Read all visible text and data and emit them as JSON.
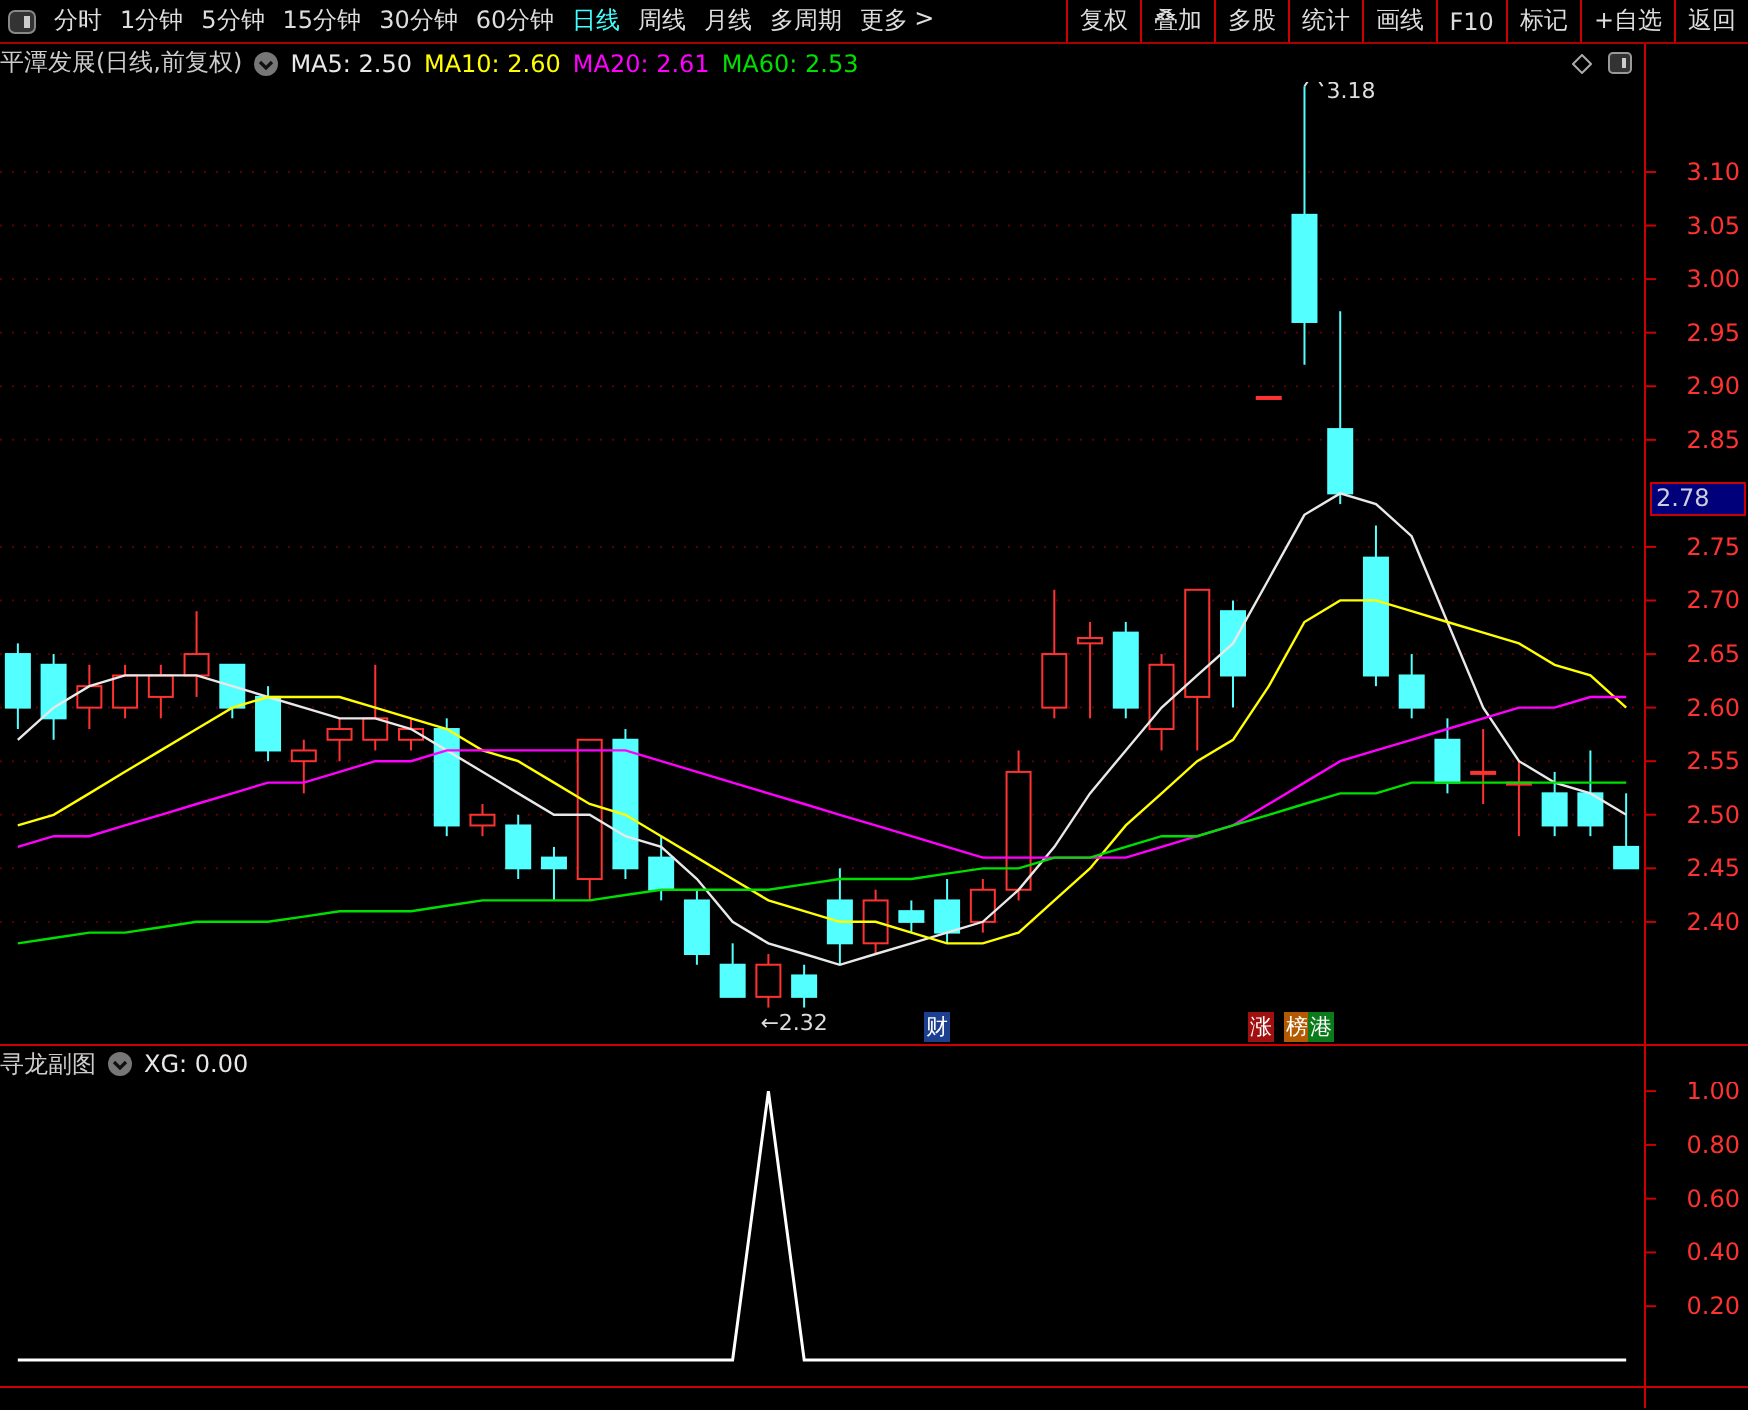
{
  "toolbar": {
    "periods": [
      {
        "label": "分时",
        "selected": false
      },
      {
        "label": "1分钟",
        "selected": false
      },
      {
        "label": "5分钟",
        "selected": false
      },
      {
        "label": "15分钟",
        "selected": false
      },
      {
        "label": "30分钟",
        "selected": false
      },
      {
        "label": "60分钟",
        "selected": false
      },
      {
        "label": "日线",
        "selected": true
      },
      {
        "label": "周线",
        "selected": false
      },
      {
        "label": "月线",
        "selected": false
      },
      {
        "label": "多周期",
        "selected": false
      }
    ],
    "more": {
      "label": "更多",
      "caret": ">"
    },
    "buttons": [
      "复权",
      "叠加",
      "多股",
      "统计",
      "画线",
      "F10",
      "标记",
      "+自选",
      "返回"
    ]
  },
  "main_chart": {
    "title": "平潭发展(日线,前复权)",
    "legend": [
      {
        "label": "MA5: 2.50",
        "color": "#e8e8e8"
      },
      {
        "label": "MA10: 2.60",
        "color": "#ffff00"
      },
      {
        "label": "MA20: 2.61",
        "color": "#ff00ff"
      },
      {
        "label": "MA60: 2.53",
        "color": "#00e000"
      }
    ],
    "chart_data": {
      "type": "candlestick",
      "grid": true,
      "ylim": [
        2.286,
        3.184
      ],
      "yticks": [
        {
          "value": 3.1,
          "label": "3.10"
        },
        {
          "value": 3.05,
          "label": "3.05"
        },
        {
          "value": 3.0,
          "label": "3.00"
        },
        {
          "value": 2.95,
          "label": "2.95"
        },
        {
          "value": 2.9,
          "label": "2.90"
        },
        {
          "value": 2.85,
          "label": "2.85"
        },
        {
          "value": 2.75,
          "label": "2.75"
        },
        {
          "value": 2.7,
          "label": "2.70"
        },
        {
          "value": 2.65,
          "label": "2.65"
        },
        {
          "value": 2.6,
          "label": "2.60"
        },
        {
          "value": 2.55,
          "label": "2.55"
        },
        {
          "value": 2.5,
          "label": "2.50"
        },
        {
          "value": 2.45,
          "label": "2.45"
        },
        {
          "value": 2.4,
          "label": "2.40"
        }
      ],
      "ohlc": [
        [
          2.65,
          2.66,
          2.58,
          2.6
        ],
        [
          2.64,
          2.65,
          2.57,
          2.59
        ],
        [
          2.6,
          2.64,
          2.58,
          2.62
        ],
        [
          2.6,
          2.64,
          2.59,
          2.63
        ],
        [
          2.61,
          2.64,
          2.59,
          2.63
        ],
        [
          2.63,
          2.69,
          2.61,
          2.65
        ],
        [
          2.64,
          2.64,
          2.59,
          2.6
        ],
        [
          2.61,
          2.62,
          2.55,
          2.56
        ],
        [
          2.55,
          2.57,
          2.52,
          2.56
        ],
        [
          2.57,
          2.59,
          2.55,
          2.58
        ],
        [
          2.57,
          2.64,
          2.56,
          2.59
        ],
        [
          2.57,
          2.59,
          2.56,
          2.58
        ],
        [
          2.58,
          2.59,
          2.48,
          2.49
        ],
        [
          2.49,
          2.51,
          2.48,
          2.5
        ],
        [
          2.49,
          2.5,
          2.44,
          2.45
        ],
        [
          2.46,
          2.47,
          2.42,
          2.45
        ],
        [
          2.44,
          2.57,
          2.42,
          2.57
        ],
        [
          2.57,
          2.58,
          2.44,
          2.45
        ],
        [
          2.46,
          2.48,
          2.42,
          2.43
        ],
        [
          2.42,
          2.43,
          2.36,
          2.37
        ],
        [
          2.36,
          2.38,
          2.33,
          2.33
        ],
        [
          2.33,
          2.37,
          2.32,
          2.36
        ],
        [
          2.35,
          2.36,
          2.32,
          2.33
        ],
        [
          2.42,
          2.45,
          2.36,
          2.38
        ],
        [
          2.38,
          2.43,
          2.37,
          2.42
        ],
        [
          2.41,
          2.42,
          2.39,
          2.4
        ],
        [
          2.42,
          2.44,
          2.38,
          2.39
        ],
        [
          2.4,
          2.44,
          2.39,
          2.43
        ],
        [
          2.43,
          2.56,
          2.42,
          2.54
        ],
        [
          2.6,
          2.71,
          2.59,
          2.65
        ],
        [
          2.66,
          2.68,
          2.59,
          2.665
        ],
        [
          2.67,
          2.68,
          2.59,
          2.6
        ],
        [
          2.58,
          2.65,
          2.56,
          2.64
        ],
        [
          2.61,
          2.71,
          2.56,
          2.71
        ],
        [
          2.69,
          2.7,
          2.6,
          2.63
        ],
        [
          2.89,
          2.89,
          2.89,
          2.89
        ],
        [
          3.06,
          3.18,
          2.92,
          2.96
        ],
        [
          2.86,
          2.97,
          2.79,
          2.8
        ],
        [
          2.74,
          2.77,
          2.62,
          2.63
        ],
        [
          2.63,
          2.65,
          2.59,
          2.6
        ],
        [
          2.57,
          2.59,
          2.52,
          2.53
        ],
        [
          2.54,
          2.58,
          2.51,
          2.54
        ],
        [
          2.53,
          2.55,
          2.48,
          2.53
        ],
        [
          2.52,
          2.54,
          2.48,
          2.49
        ],
        [
          2.52,
          2.56,
          2.48,
          2.49
        ],
        [
          2.47,
          2.52,
          2.45,
          2.45
        ]
      ],
      "series": [
        {
          "type": "line",
          "color": "#e8e8e8",
          "values": [
            2.57,
            2.6,
            2.62,
            2.63,
            2.63,
            2.63,
            2.62,
            2.61,
            2.6,
            2.59,
            2.59,
            2.58,
            2.56,
            2.54,
            2.52,
            2.5,
            2.5,
            2.48,
            2.47,
            2.44,
            2.4,
            2.38,
            2.37,
            2.36,
            2.37,
            2.38,
            2.39,
            2.4,
            2.43,
            2.47,
            2.52,
            2.56,
            2.6,
            2.63,
            2.66,
            2.72,
            2.78,
            2.8,
            2.79,
            2.76,
            2.68,
            2.6,
            2.55,
            2.53,
            2.52,
            2.5
          ]
        },
        {
          "type": "line",
          "color": "#ffff00",
          "values": [
            2.49,
            2.5,
            2.52,
            2.54,
            2.56,
            2.58,
            2.6,
            2.61,
            2.61,
            2.61,
            2.6,
            2.59,
            2.58,
            2.56,
            2.55,
            2.53,
            2.51,
            2.5,
            2.48,
            2.46,
            2.44,
            2.42,
            2.41,
            2.4,
            2.4,
            2.39,
            2.38,
            2.38,
            2.39,
            2.42,
            2.45,
            2.49,
            2.52,
            2.55,
            2.57,
            2.62,
            2.68,
            2.7,
            2.7,
            2.69,
            2.68,
            2.67,
            2.66,
            2.64,
            2.63,
            2.6
          ]
        },
        {
          "type": "line",
          "color": "#ff00ff",
          "values": [
            2.47,
            2.48,
            2.48,
            2.49,
            2.5,
            2.51,
            2.52,
            2.53,
            2.53,
            2.54,
            2.55,
            2.55,
            2.56,
            2.56,
            2.56,
            2.56,
            2.56,
            2.56,
            2.55,
            2.54,
            2.53,
            2.52,
            2.51,
            2.5,
            2.49,
            2.48,
            2.47,
            2.46,
            2.46,
            2.46,
            2.46,
            2.46,
            2.47,
            2.48,
            2.49,
            2.51,
            2.53,
            2.55,
            2.56,
            2.57,
            2.58,
            2.59,
            2.6,
            2.6,
            2.61,
            2.61
          ]
        },
        {
          "type": "line",
          "color": "#00e000",
          "values": [
            2.38,
            2.385,
            2.39,
            2.39,
            2.395,
            2.4,
            2.4,
            2.4,
            2.405,
            2.41,
            2.41,
            2.41,
            2.415,
            2.42,
            2.42,
            2.42,
            2.42,
            2.425,
            2.43,
            2.43,
            2.43,
            2.43,
            2.435,
            2.44,
            2.44,
            2.44,
            2.445,
            2.45,
            2.45,
            2.46,
            2.46,
            2.47,
            2.48,
            2.48,
            2.49,
            2.5,
            2.51,
            2.52,
            2.52,
            2.53,
            2.53,
            2.53,
            2.53,
            2.53,
            2.53,
            2.53
          ]
        }
      ],
      "annotations": [
        "3.18",
        "←2.32"
      ]
    },
    "cursor_price": "2.78",
    "events": [
      {
        "label": "财",
        "color": "#1c3f8f"
      },
      {
        "label": "涨",
        "color": "#a01010"
      },
      {
        "label": "榜",
        "color": "#b35a00"
      },
      {
        "label": "港",
        "color": "#0a7a1a"
      }
    ]
  },
  "sub_chart": {
    "title": "寻龙副图",
    "legend": [
      {
        "label": "XG: 0.00",
        "color": "#e8e8e8"
      }
    ],
    "chart_data": {
      "type": "line",
      "ylim": [
        -0.097,
        1.034
      ],
      "yticks": [
        {
          "value": 1.0,
          "label": "1.00"
        },
        {
          "value": 0.8,
          "label": "0.80"
        },
        {
          "value": 0.6,
          "label": "0.60"
        },
        {
          "value": 0.4,
          "label": "0.40"
        },
        {
          "value": 0.2,
          "label": "0.20"
        }
      ],
      "series": [
        {
          "color": "#ffffff",
          "values": [
            0,
            0,
            0,
            0,
            0,
            0,
            0,
            0,
            0,
            0,
            0,
            0,
            0,
            0,
            0,
            0,
            0,
            0,
            0,
            0,
            0,
            1,
            0,
            0,
            0,
            0,
            0,
            0,
            0,
            0,
            0,
            0,
            0,
            0,
            0,
            0,
            0,
            0,
            0,
            0,
            0,
            0,
            0,
            0,
            0,
            0
          ]
        }
      ]
    }
  }
}
